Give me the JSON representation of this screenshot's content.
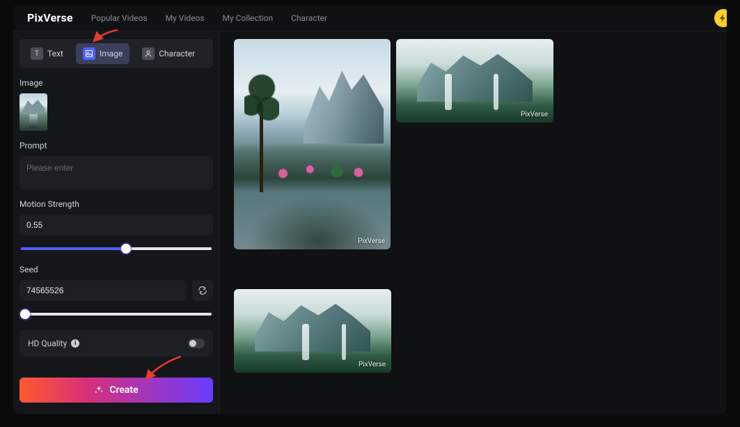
{
  "brand": "PixVerse",
  "nav": {
    "popular": "Popular Videos",
    "myvideos": "My Videos",
    "collection": "My Collection",
    "character": "Character"
  },
  "modes": {
    "text": "Text",
    "image": "Image",
    "character": "Character"
  },
  "labels": {
    "image": "Image",
    "prompt": "Prompt",
    "motion": "Motion Strength",
    "seed": "Seed",
    "hd": "HD Quality"
  },
  "prompt": {
    "placeholder": "Please enter",
    "value": ""
  },
  "motion": {
    "value": "0.55",
    "percent": 55
  },
  "seed": {
    "value": "74565526",
    "percent": 3
  },
  "hd": {
    "on": false
  },
  "create": "Create",
  "watermark": "PixVerse"
}
